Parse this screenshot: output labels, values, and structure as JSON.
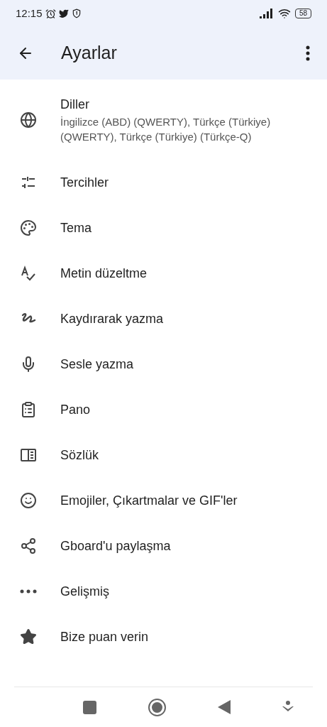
{
  "status_bar": {
    "time": "12:15",
    "battery": "58"
  },
  "toolbar": {
    "title": "Ayarlar"
  },
  "items": [
    {
      "title": "Diller",
      "subtitle": "İngilizce (ABD) (QWERTY), Türkçe (Türkiye) (QWERTY), Türkçe (Türkiye) (Türkçe-Q)"
    },
    {
      "title": "Tercihler"
    },
    {
      "title": "Tema"
    },
    {
      "title": "Metin düzeltme"
    },
    {
      "title": "Kaydırarak yazma"
    },
    {
      "title": "Sesle yazma"
    },
    {
      "title": "Pano"
    },
    {
      "title": "Sözlük"
    },
    {
      "title": "Emojiler, Çıkartmalar ve GIF'ler"
    },
    {
      "title": "Gboard'u paylaşma"
    },
    {
      "title": "Gelişmiş"
    },
    {
      "title": "Bize puan verin"
    }
  ]
}
